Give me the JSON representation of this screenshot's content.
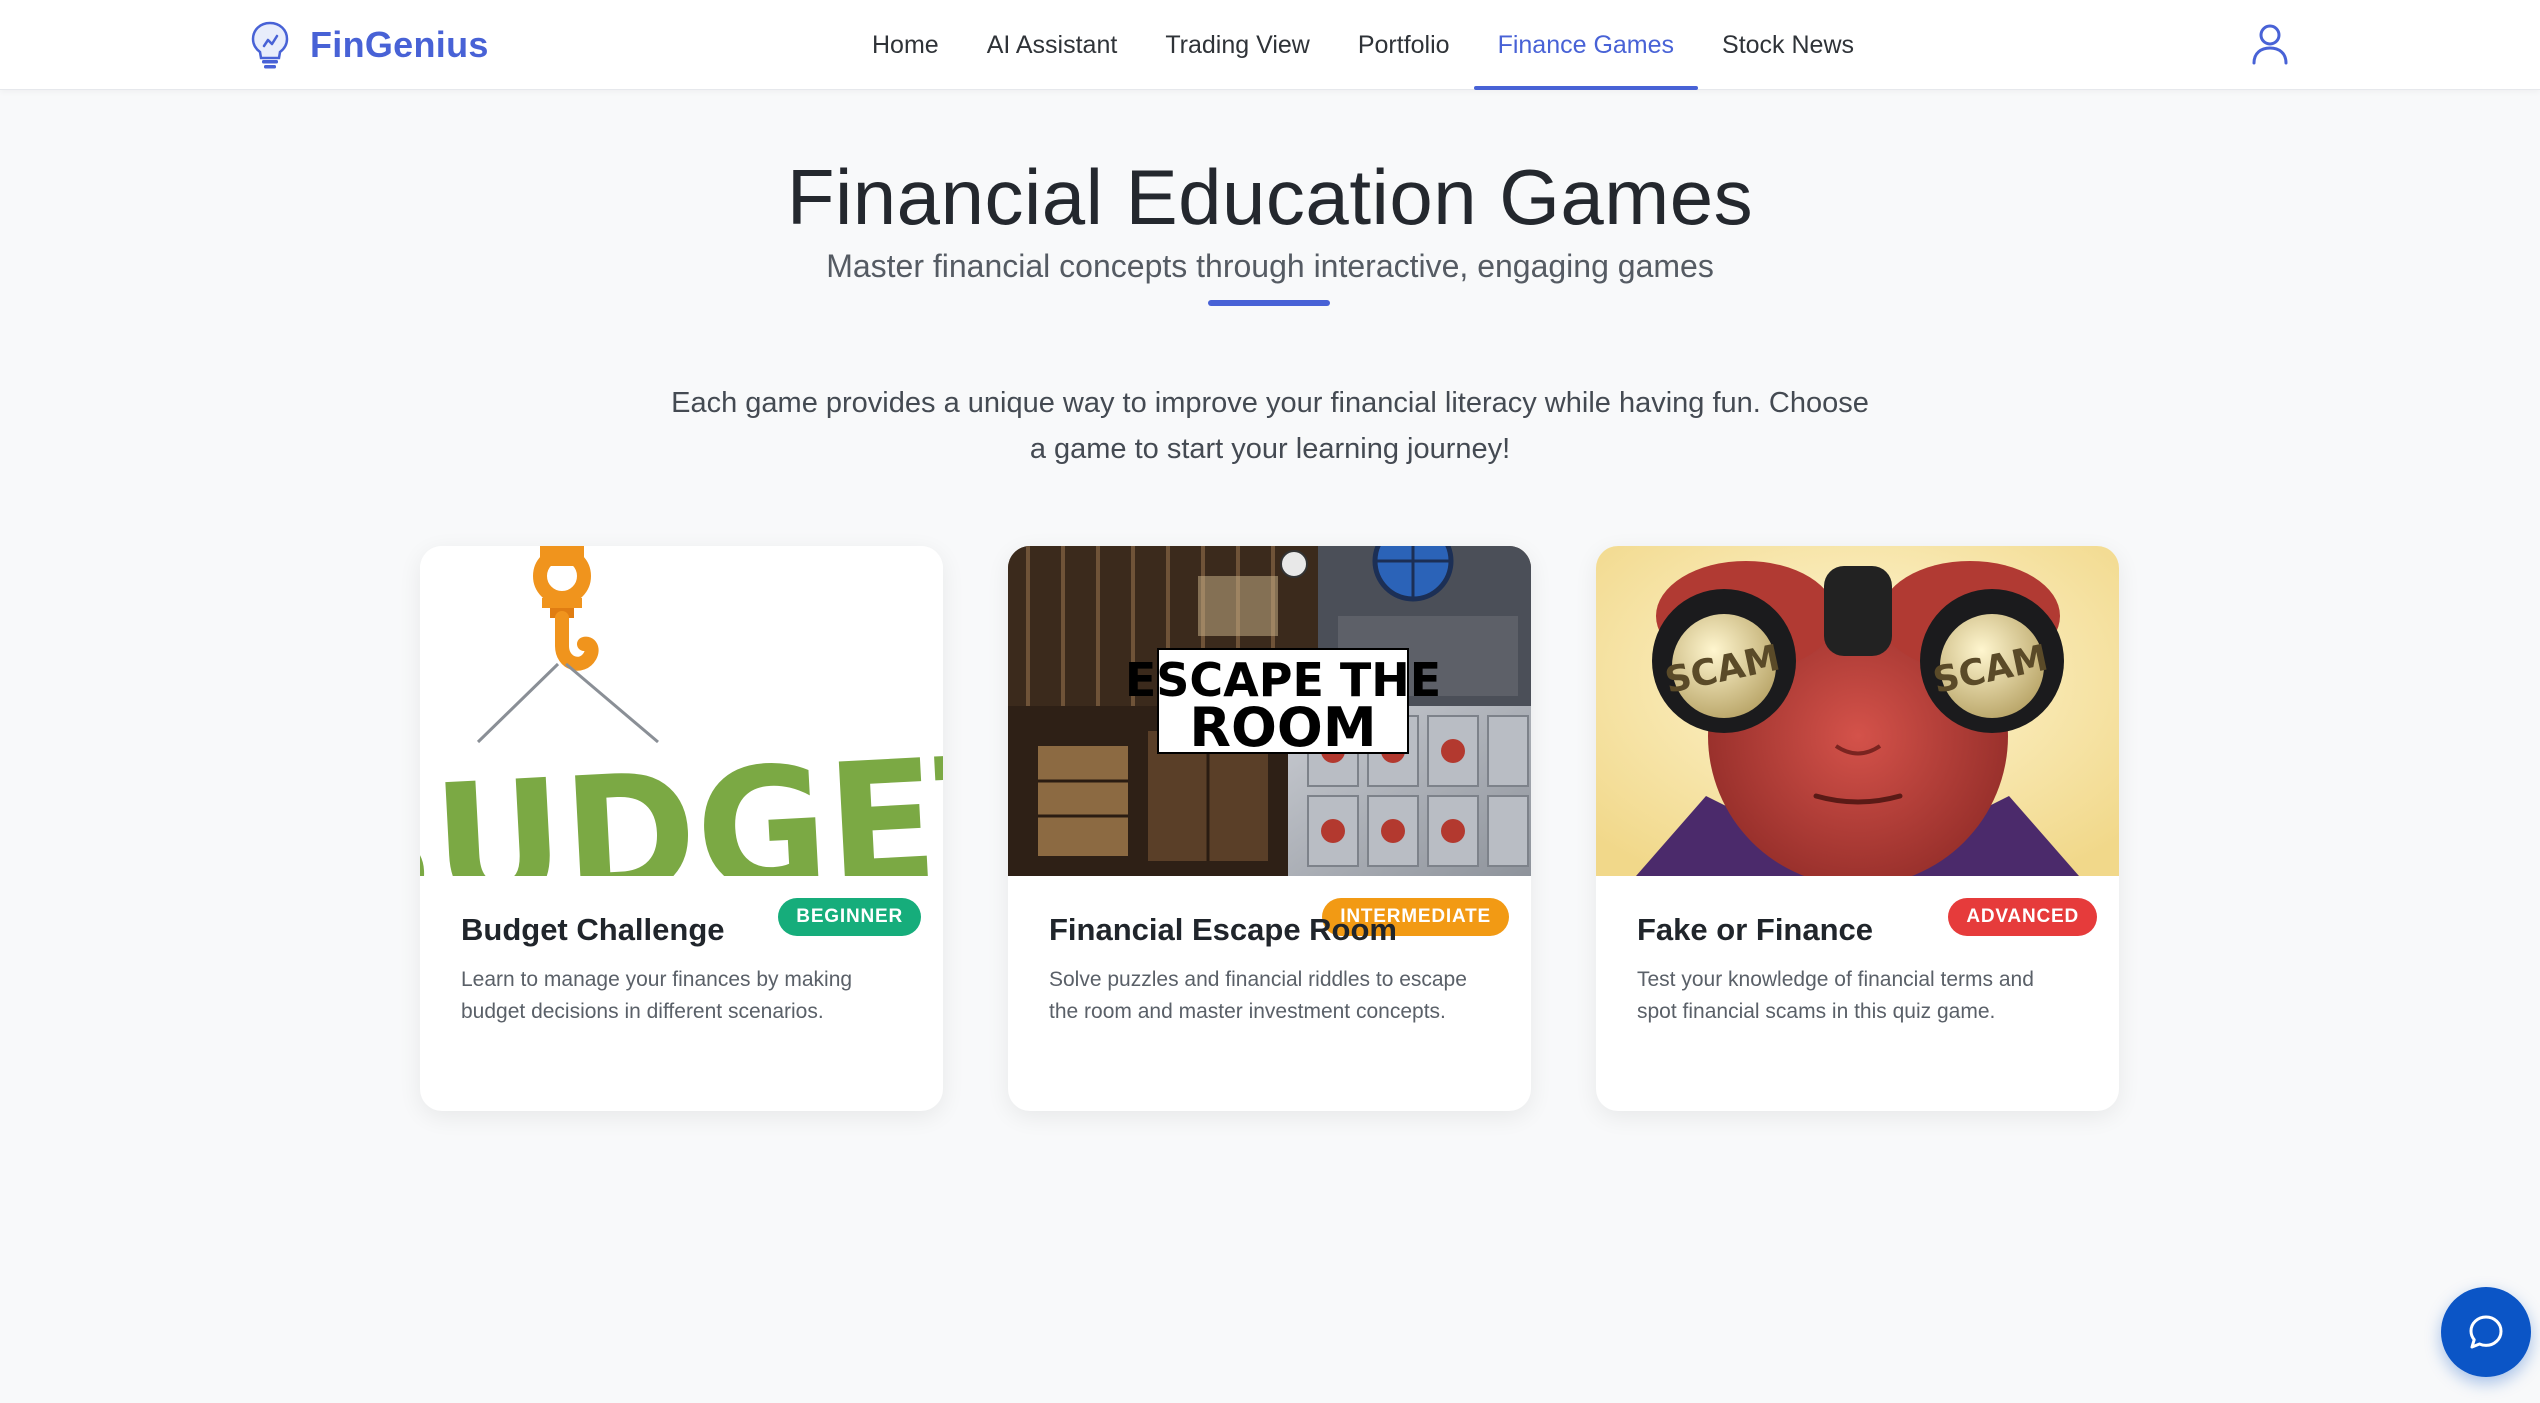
{
  "brand": {
    "name": "FinGenius",
    "icon": "lightbulb-icon",
    "color": "#4862d6"
  },
  "nav": {
    "links": [
      {
        "label": "Home",
        "active": false
      },
      {
        "label": "AI Assistant",
        "active": false
      },
      {
        "label": "Trading View",
        "active": false
      },
      {
        "label": "Portfolio",
        "active": false
      },
      {
        "label": "Finance Games",
        "active": true
      },
      {
        "label": "Stock News",
        "active": false
      }
    ],
    "user_icon": "user-icon"
  },
  "header": {
    "title": "Financial Education Games",
    "subtitle": "Master financial concepts through interactive, engaging games",
    "intro": "Each game provides a unique way to improve your financial literacy while having fun. Choose a game to start your learning journey!"
  },
  "games": [
    {
      "title": "Budget Challenge",
      "level": "BEGINNER",
      "level_color": "#16ad7b",
      "description": "Learn to manage your finances by making budget decisions in different scenarios.",
      "image_text": "BUDGET"
    },
    {
      "title": "Financial Escape Room",
      "level": "INTERMEDIATE",
      "level_color": "#f29a14",
      "description": "Solve puzzles and financial riddles to escape the room and master investment concepts.",
      "image_text_line1": "ESCAPE THE",
      "image_text_line2": "ROOM"
    },
    {
      "title": "Fake or Finance",
      "level": "ADVANCED",
      "level_color": "#e63b3b",
      "description": "Test your knowledge of financial terms and spot financial scams in this quiz game.",
      "image_text": "SCAM"
    }
  ],
  "chat": {
    "icon": "chat-bubble-icon",
    "color": "#0b55c6"
  }
}
